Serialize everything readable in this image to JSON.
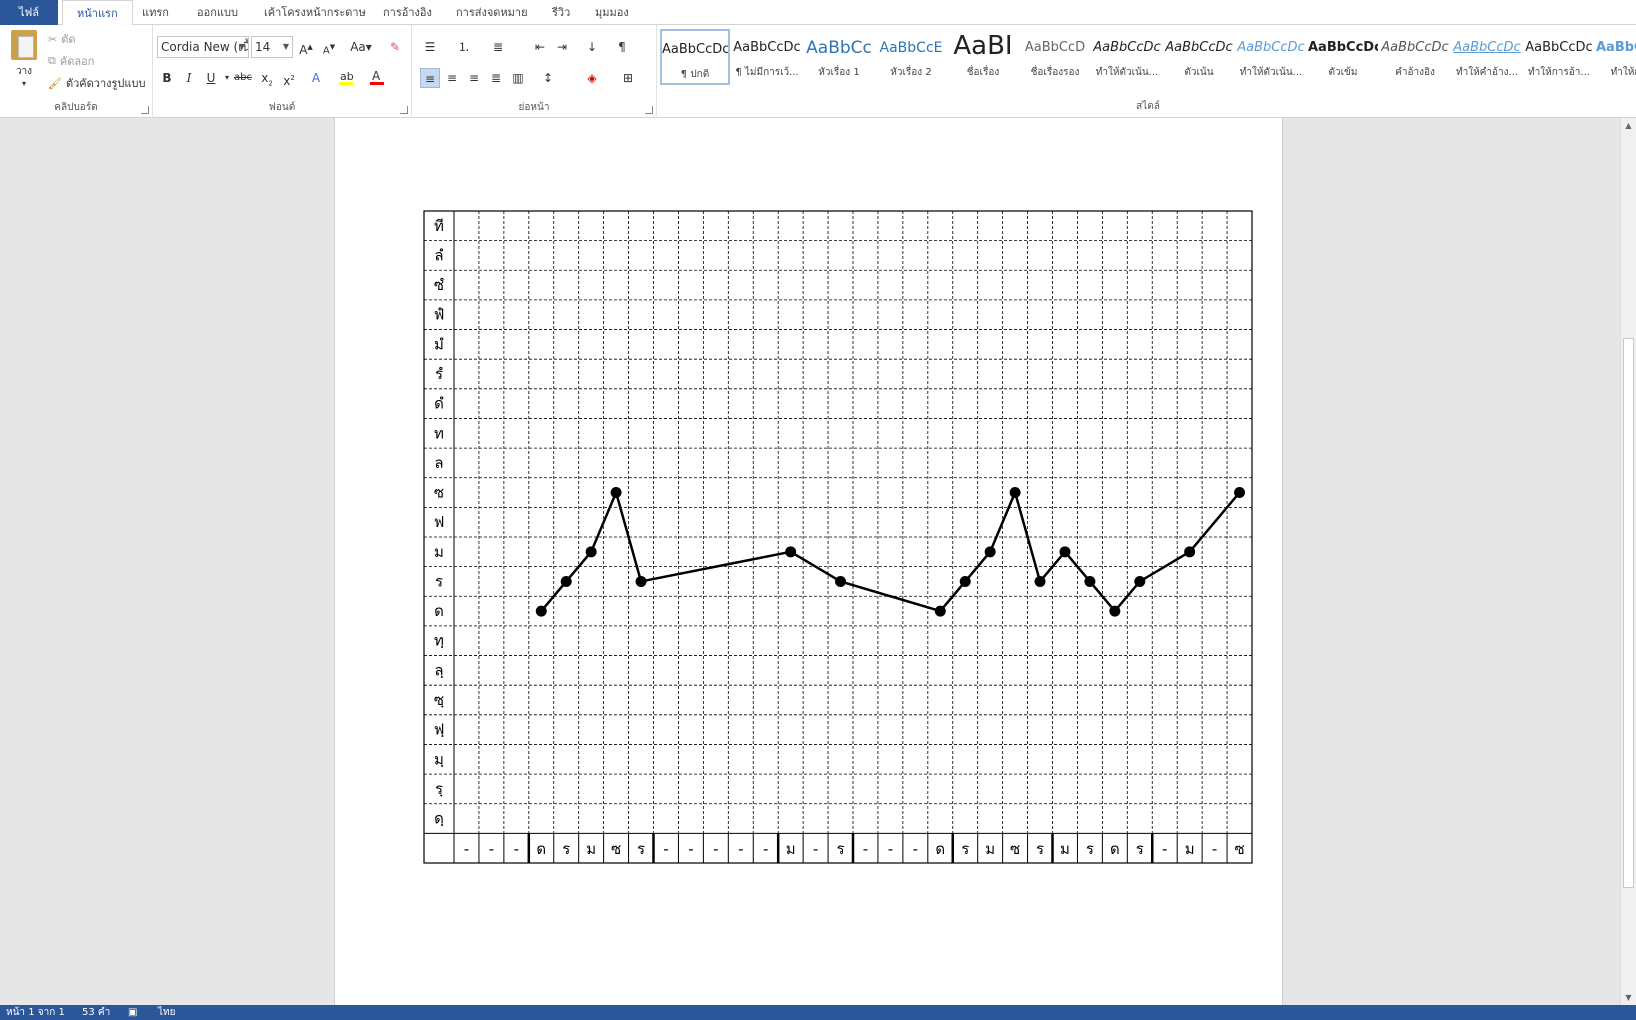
{
  "tabs": [
    "ไฟล์",
    "หน้าแรก",
    "แทรก",
    "ออกแบบ",
    "เค้าโครงหน้ากระดาษ",
    "การอ้างอิง",
    "การส่งจดหมาย",
    "รีวิว",
    "มุมมอง"
  ],
  "clipboard": {
    "paste_label": "วาง",
    "cut_label": "ตัด",
    "copy_label": "คัดลอก",
    "format_painter_label": "ตัวคัดวางรูปแบบ",
    "group_label": "คลิปบอร์ด"
  },
  "font": {
    "name": "Cordia New (เนื้",
    "size": "14",
    "change_case": "Aa",
    "group_label": "ฟอนต์",
    "highlight_color": "#ffff00",
    "font_color": "#ff0000"
  },
  "paragraph": {
    "group_label": "ย่อหน้า"
  },
  "styles": {
    "group_label": "สไตล์",
    "items": [
      {
        "sample": "AaBbCcDc",
        "name": "¶ ปกติ"
      },
      {
        "sample": "AaBbCcDc",
        "name": "¶ ไม่มีการเว้..."
      },
      {
        "sample": "AaBbCc",
        "name": "หัวเรื่อง 1"
      },
      {
        "sample": "AaBbCcE",
        "name": "หัวเรื่อง 2"
      },
      {
        "sample": "AaBI",
        "name": "ชื่อเรื่อง"
      },
      {
        "sample": "AaBbCcD",
        "name": "ชื่อเรื่องรอง"
      },
      {
        "sample": "AaBbCcDc",
        "name": "ทำให้ตัวเน้น..."
      },
      {
        "sample": "AaBbCcDc",
        "name": "ตัวเน้น"
      },
      {
        "sample": "AaBbCcDc",
        "name": "ทำให้ตัวเน้น..."
      },
      {
        "sample": "AaBbCcDc",
        "name": "ตัวเข้ม"
      },
      {
        "sample": "AaBbCcDc",
        "name": "คำอ้างอิง"
      },
      {
        "sample": "AaBbCcDc",
        "name": "ทำให้คำอ้าง..."
      },
      {
        "sample": "AaBbCcDc",
        "name": "ทำให้การอ้า..."
      },
      {
        "sample": "AaBbCcDc",
        "name": "ทำให้การ"
      }
    ]
  },
  "chart_data": {
    "type": "line",
    "y_labels_top_to_bottom": [
      "ที",
      "ลํ",
      "ซํ",
      "ฟํ",
      "มํ",
      "รํ",
      "ดํ",
      "ท",
      "ล",
      "ซ",
      "ฟ",
      "ม",
      "ร",
      "ด",
      "ทฺ",
      "ลฺ",
      "ซฺ",
      "ฟฺ",
      "มฺ",
      "รฺ",
      "ดฺ"
    ],
    "x_labels": [
      "-",
      "-",
      "-",
      "ด",
      "ร",
      "ม",
      "ซ",
      "ร",
      "-",
      "-",
      "-",
      "-",
      "-",
      "ม",
      "-",
      "ร",
      "-",
      "-",
      "-",
      "ด",
      "ร",
      "ม",
      "ซ",
      "ร",
      "ม",
      "ร",
      "ด",
      "ร",
      "-",
      "ม",
      "-",
      "ซ"
    ],
    "points": [
      {
        "x": 4,
        "y": "ด"
      },
      {
        "x": 5,
        "y": "ร"
      },
      {
        "x": 6,
        "y": "ม"
      },
      {
        "x": 7,
        "y": "ซ"
      },
      {
        "x": 8,
        "y": "ร"
      },
      {
        "x": 14,
        "y": "ม"
      },
      {
        "x": 16,
        "y": "ร"
      },
      {
        "x": 20,
        "y": "ด"
      },
      {
        "x": 21,
        "y": "ร"
      },
      {
        "x": 22,
        "y": "ม"
      },
      {
        "x": 23,
        "y": "ซ"
      },
      {
        "x": 24,
        "y": "ร"
      },
      {
        "x": 25,
        "y": "ม"
      },
      {
        "x": 26,
        "y": "ร"
      },
      {
        "x": 27,
        "y": "ด"
      },
      {
        "x": 28,
        "y": "ร"
      },
      {
        "x": 30,
        "y": "ม"
      },
      {
        "x": 32,
        "y": "ซ"
      }
    ],
    "bar_divider_after_columns": [
      3,
      8,
      13,
      16,
      20,
      24,
      28
    ]
  },
  "status": {
    "page": "หน้า 1 จาก 1",
    "words": "53 คำ",
    "language": "ไทย"
  }
}
